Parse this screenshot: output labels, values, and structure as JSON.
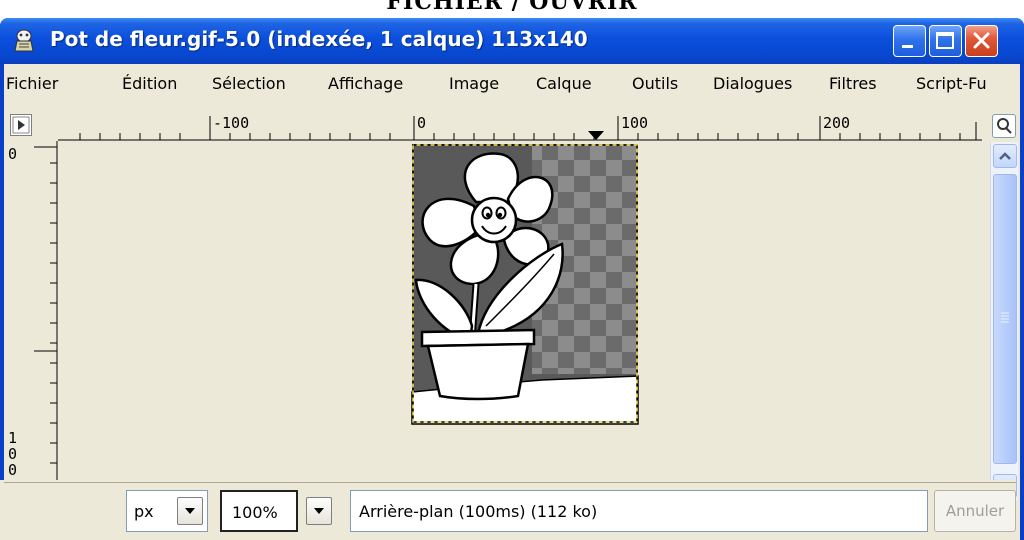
{
  "banner": {
    "text": "FICHIER / OUVRIR"
  },
  "window": {
    "title": "Pot de fleur.gif-5.0 (indexée, 1 calque) 113x140",
    "colors": {
      "titlebar": "#0a4fdc",
      "close": "#e0593a",
      "client": "#ece9d8"
    }
  },
  "menu": {
    "items": [
      {
        "label": "Fichier"
      },
      {
        "label": "Édition"
      },
      {
        "label": "Sélection"
      },
      {
        "label": "Affichage"
      },
      {
        "label": "Image"
      },
      {
        "label": "Calque"
      },
      {
        "label": "Outils"
      },
      {
        "label": "Dialogues"
      },
      {
        "label": "Filtres"
      },
      {
        "label": "Script-Fu"
      }
    ]
  },
  "rulers": {
    "horizontal_labels": [
      "-100",
      "0",
      "100",
      "200"
    ],
    "vertical_label_top": "0",
    "vertical_label_bottom": [
      "1",
      "0",
      "0"
    ]
  },
  "status": {
    "unit": "px",
    "zoom": "100%",
    "message": "Arrière-plan (100ms) (112 ko)",
    "cancel_label": "Annuler"
  },
  "icons": {
    "menu_button": "play-triangle-icon",
    "zoom_button": "magnifier-icon",
    "quick_mask": "quick-mask-icon",
    "navigate": "move-cross-icon"
  }
}
